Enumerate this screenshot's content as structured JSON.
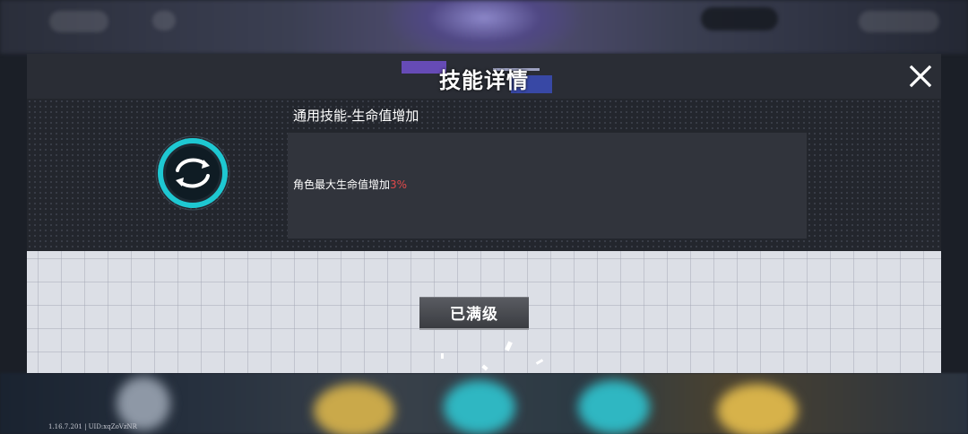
{
  "dialog": {
    "title": "技能详情",
    "close_icon": "close-icon"
  },
  "skill": {
    "icon": "cycle-arrows-icon",
    "name": "通用技能-生命值增加",
    "description_prefix": "角色最大生命值增加",
    "description_value": "3%"
  },
  "action": {
    "max_level_label": "已满级"
  },
  "footer": {
    "version": "1.16.7.201 | UID:xqZoVzNR"
  },
  "colors": {
    "highlight": "#e24a4a",
    "icon_accent": "#1ec8d2",
    "panel_dark": "#23262d",
    "panel_light": "#dcdfe6"
  }
}
